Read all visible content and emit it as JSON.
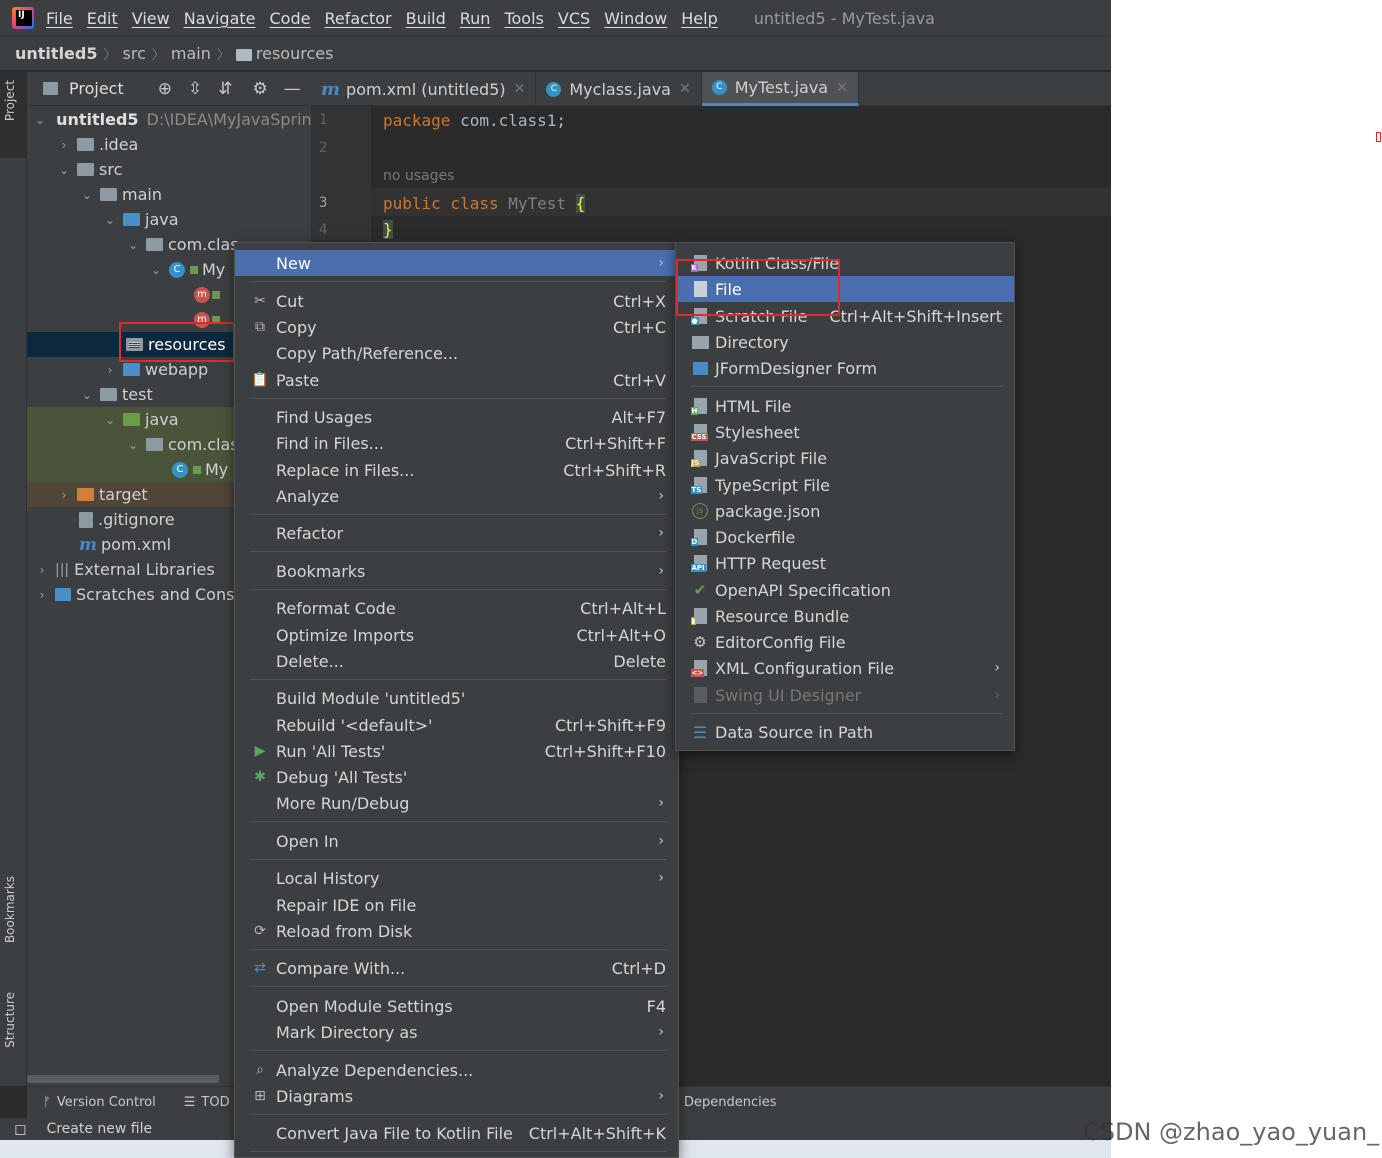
{
  "menu": {
    "items": [
      "File",
      "Edit",
      "View",
      "Navigate",
      "Code",
      "Refactor",
      "Build",
      "Run",
      "Tools",
      "VCS",
      "Window",
      "Help"
    ],
    "window_title": "untitled5 - MyTest.java"
  },
  "breadcrumb": [
    "untitled5",
    "src",
    "main",
    "resources"
  ],
  "stripe": {
    "project": "Project",
    "bookmarks": "Bookmarks",
    "structure": "Structure"
  },
  "project_panel": {
    "title": "Project",
    "tree": [
      {
        "label": "untitled5",
        "path": "D:\\IDEA\\MyJavaSprin"
      },
      {
        "label": ".idea"
      },
      {
        "label": "src"
      },
      {
        "label": "main"
      },
      {
        "label": "java"
      },
      {
        "label": "com.clas"
      },
      {
        "label": "My"
      },
      {
        "label": "resources"
      },
      {
        "label": "webapp"
      },
      {
        "label": "test"
      },
      {
        "label": "java"
      },
      {
        "label": "com.clas"
      },
      {
        "label": "My"
      },
      {
        "label": "target"
      },
      {
        "label": ".gitignore"
      },
      {
        "label": "pom.xml"
      },
      {
        "label": "External Libraries"
      },
      {
        "label": "Scratches and Consol"
      }
    ]
  },
  "tabs": [
    {
      "label": "pom.xml (untitled5)"
    },
    {
      "label": "Myclass.java"
    },
    {
      "label": "MyTest.java"
    }
  ],
  "editor": {
    "line_numbers": [
      "1",
      "2",
      "3",
      "4"
    ],
    "line1_kw": "package",
    "line1_rest": " com.class1;",
    "usages_hint": "no usages",
    "line3_kw": "public class",
    "line3_name": "MyTest",
    "line3_brace": "{",
    "line4": "}"
  },
  "context_menu": {
    "items": [
      {
        "label": "New",
        "submenu": true
      },
      {
        "label": "Cut",
        "shortcut": "Ctrl+X"
      },
      {
        "label": "Copy",
        "shortcut": "Ctrl+C"
      },
      {
        "label": "Copy Path/Reference..."
      },
      {
        "label": "Paste",
        "shortcut": "Ctrl+V"
      },
      {
        "label": "Find Usages",
        "shortcut": "Alt+F7"
      },
      {
        "label": "Find in Files...",
        "shortcut": "Ctrl+Shift+F"
      },
      {
        "label": "Replace in Files...",
        "shortcut": "Ctrl+Shift+R"
      },
      {
        "label": "Analyze",
        "submenu": true
      },
      {
        "label": "Refactor",
        "submenu": true
      },
      {
        "label": "Bookmarks",
        "submenu": true
      },
      {
        "label": "Reformat Code",
        "shortcut": "Ctrl+Alt+L"
      },
      {
        "label": "Optimize Imports",
        "shortcut": "Ctrl+Alt+O"
      },
      {
        "label": "Delete...",
        "shortcut": "Delete"
      },
      {
        "label": "Build Module 'untitled5'"
      },
      {
        "label": "Rebuild '<default>'",
        "shortcut": "Ctrl+Shift+F9"
      },
      {
        "label": "Run 'All Tests'",
        "shortcut": "Ctrl+Shift+F10"
      },
      {
        "label": "Debug 'All Tests'"
      },
      {
        "label": "More Run/Debug",
        "submenu": true
      },
      {
        "label": "Open In",
        "submenu": true
      },
      {
        "label": "Local History",
        "submenu": true
      },
      {
        "label": "Repair IDE on File"
      },
      {
        "label": "Reload from Disk"
      },
      {
        "label": "Compare With...",
        "shortcut": "Ctrl+D"
      },
      {
        "label": "Open Module Settings",
        "shortcut": "F4"
      },
      {
        "label": "Mark Directory as",
        "submenu": true
      },
      {
        "label": "Analyze Dependencies..."
      },
      {
        "label": "Diagrams",
        "submenu": true
      },
      {
        "label": "Convert Java File to Kotlin File",
        "shortcut": "Ctrl+Alt+Shift+K"
      }
    ]
  },
  "new_submenu": {
    "items": [
      {
        "label": "Kotlin Class/File"
      },
      {
        "label": "File"
      },
      {
        "label": "Scratch File",
        "shortcut": "Ctrl+Alt+Shift+Insert"
      },
      {
        "label": "Directory"
      },
      {
        "label": "JFormDesigner Form"
      },
      {
        "label": "HTML File"
      },
      {
        "label": "Stylesheet"
      },
      {
        "label": "JavaScript File"
      },
      {
        "label": "TypeScript File"
      },
      {
        "label": "package.json"
      },
      {
        "label": "Dockerfile"
      },
      {
        "label": "HTTP Request"
      },
      {
        "label": "OpenAPI Specification"
      },
      {
        "label": "Resource Bundle"
      },
      {
        "label": "EditorConfig File"
      },
      {
        "label": "XML Configuration File",
        "submenu": true
      },
      {
        "label": "Swing UI Designer",
        "submenu": true,
        "disabled": true
      },
      {
        "label": "Data Source in Path"
      }
    ]
  },
  "bottom": {
    "version_control": "Version Control",
    "todo": "TOD",
    "dependencies": "Dependencies",
    "status": "Create new file"
  },
  "watermark": "CSDN @zhao_yao_yuan_",
  "colors": {
    "selection": "#4b6eaf",
    "highlight_box": "#e0282e",
    "tree_selection": "#0d293e"
  }
}
